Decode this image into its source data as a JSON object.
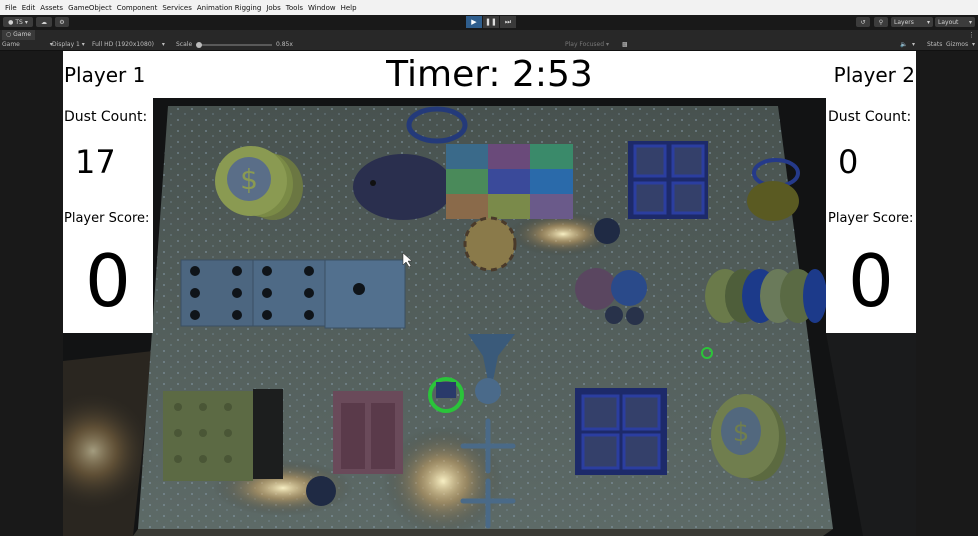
{
  "menu": [
    "File",
    "Edit",
    "Assets",
    "GameObject",
    "Component",
    "Services",
    "Animation Rigging",
    "Jobs",
    "Tools",
    "Window",
    "Help"
  ],
  "toolbar": {
    "account": "TS",
    "layers": "Layers",
    "layout": "Layout"
  },
  "game_view": {
    "tab_label": "Game",
    "mode": "Game",
    "display": "Display 1",
    "resolution": "Full HD (1920x1080)",
    "scale_label": "Scale",
    "scale_value": "0.85x",
    "play_focused": "Play Focused",
    "stats": "Stats",
    "gizmos": "Gizmos"
  },
  "hud": {
    "timer": "Timer: 2:53",
    "player1": {
      "name": "Player 1",
      "dust_label": "Dust Count:",
      "dust": "17",
      "score_label": "Player Score:",
      "score": "0"
    },
    "player2": {
      "name": "Player 2",
      "dust_label": "Dust Count:",
      "dust": "0",
      "score_label": "Player Score:",
      "score": "0"
    }
  },
  "colors": {
    "play_active": "#2f5e8d",
    "floor": "#5a6664",
    "hud_bg": "#ffffff"
  }
}
